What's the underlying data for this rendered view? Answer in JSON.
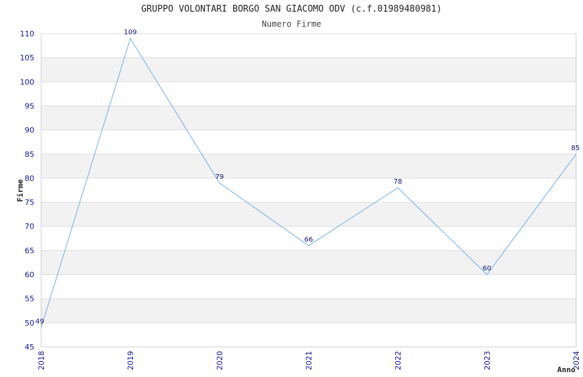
{
  "chart_data": {
    "type": "line",
    "title": "GRUPPO VOLONTARI BORGO SAN GIACOMO ODV (c.f.01989480981)",
    "subtitle": "Numero Firme",
    "xlabel": "Anno",
    "ylabel": "Firme",
    "x": [
      "2018",
      "2019",
      "2020",
      "2021",
      "2022",
      "2023",
      "2024"
    ],
    "series": [
      {
        "values": [
          49,
          109,
          79,
          66,
          78,
          60,
          85
        ]
      }
    ],
    "ylim": [
      45,
      110
    ],
    "yticks": [
      45,
      50,
      55,
      60,
      65,
      70,
      75,
      80,
      85,
      90,
      95,
      100,
      105,
      110
    ],
    "grid": true,
    "colors": {
      "line": "#6aaee8",
      "tick_text": "#1010b0",
      "data_label_text": "#10107a",
      "band": "#f2f2f2",
      "grid": "#dddddd",
      "axis": "#cccccc",
      "title_text": "#222222"
    }
  }
}
